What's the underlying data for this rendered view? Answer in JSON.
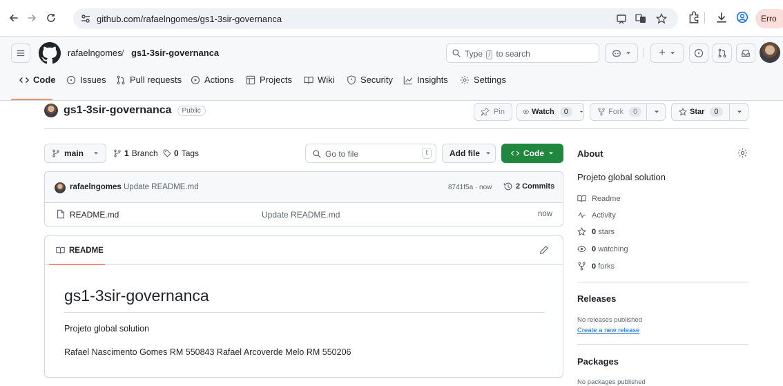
{
  "browser": {
    "url": "github.com/rafaelngomes/gs1-3sir-governanca",
    "profile_label": "Erro"
  },
  "header": {
    "owner": "rafaelngomes",
    "separator": "/",
    "repo": "gs1-3sir-governanca",
    "search_prefix": "Type",
    "search_key": "/",
    "search_suffix": "to search",
    "plus": "+"
  },
  "tabs": [
    {
      "label": "Code",
      "icon": "code-icon"
    },
    {
      "label": "Issues",
      "icon": "issue-icon"
    },
    {
      "label": "Pull requests",
      "icon": "pull-request-icon"
    },
    {
      "label": "Actions",
      "icon": "play-icon"
    },
    {
      "label": "Projects",
      "icon": "table-icon"
    },
    {
      "label": "Wiki",
      "icon": "book-icon"
    },
    {
      "label": "Security",
      "icon": "shield-icon"
    },
    {
      "label": "Insights",
      "icon": "graph-icon"
    },
    {
      "label": "Settings",
      "icon": "gear-icon"
    }
  ],
  "repo": {
    "name": "gs1-3sir-governanca",
    "visibility": "Public",
    "pin": "Pin",
    "watch": "Watch",
    "watch_count": "0",
    "fork": "Fork",
    "fork_count": "0",
    "star": "Star",
    "star_count": "0"
  },
  "toolbar": {
    "branch": "main",
    "branches_count": "1",
    "branches_label": "Branch",
    "tags_count": "0",
    "tags_label": "Tags",
    "go_to_file": "Go to file",
    "go_to_file_key": "t",
    "add_file": "Add file",
    "code": "Code"
  },
  "commit": {
    "author": "rafaelngomes",
    "message": "Update README.md",
    "hash_time": "8741f5a · now",
    "commits_label": "2 Commits"
  },
  "files": [
    {
      "name": "README.md",
      "message": "Update README.md",
      "time": "now"
    }
  ],
  "readme": {
    "tab_label": "README",
    "h1": "gs1-3sir-governanca",
    "p1": "Projeto global solution",
    "p2": "Rafael Nascimento Gomes RM 550843 Rafael Arcoverde Melo RM 550206"
  },
  "about": {
    "heading": "About",
    "description": "Projeto global solution",
    "readme": "Readme",
    "activity": "Activity",
    "stars_count": "0",
    "stars_label": "stars",
    "watching_count": "0",
    "watching_label": "watching",
    "forks_count": "0",
    "forks_label": "forks"
  },
  "releases": {
    "heading": "Releases",
    "none": "No releases published",
    "create": "Create a new release"
  },
  "packages": {
    "heading": "Packages",
    "none": "No packages published"
  }
}
